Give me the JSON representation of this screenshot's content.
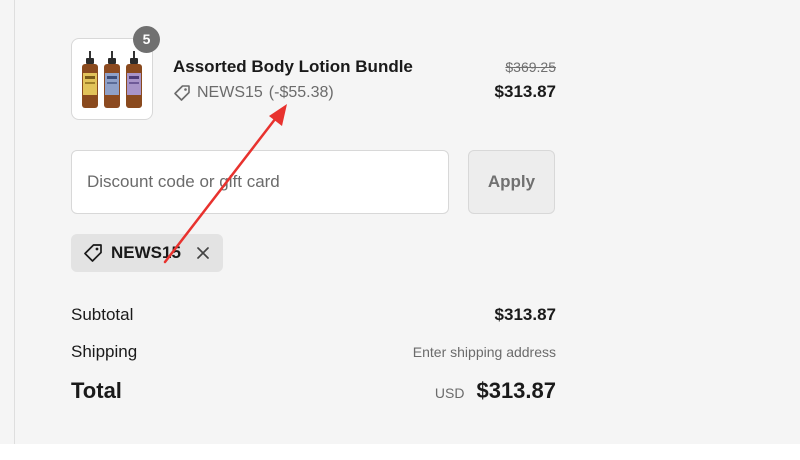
{
  "product": {
    "name": "Assorted Body Lotion Bundle",
    "quantity": "5",
    "discount_code": "NEWS15",
    "discount_amount": "(-$55.38)",
    "original_price": "$369.25",
    "price": "$313.87",
    "image_icon": "lotion-bottles-image"
  },
  "discount_form": {
    "placeholder": "Discount code or gift card",
    "value": "",
    "apply_label": "Apply"
  },
  "applied_code": {
    "label": "NEWS15",
    "tag_icon": "tag-icon",
    "remove_icon": "close-icon"
  },
  "summary": {
    "subtotal_label": "Subtotal",
    "subtotal_value": "$313.87",
    "shipping_label": "Shipping",
    "shipping_value": "Enter shipping address",
    "total_label": "Total",
    "total_currency": "USD",
    "total_value": "$313.87"
  },
  "colors": {
    "background": "#f5f5f5",
    "badge": "#707070",
    "annotation_arrow": "#e8322e",
    "chip": "#e3e3e3"
  }
}
